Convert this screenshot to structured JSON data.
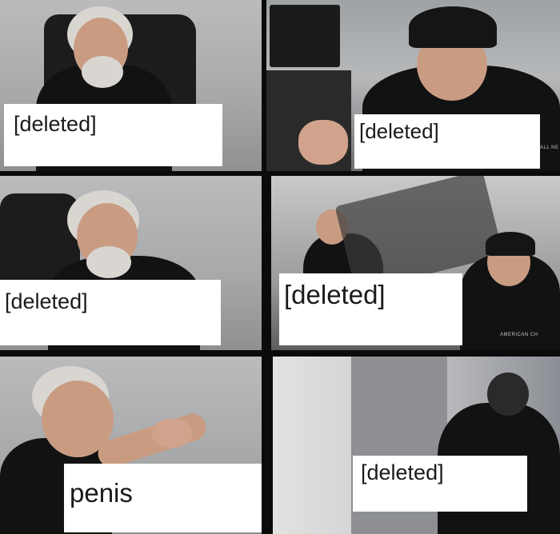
{
  "meme": {
    "template": "American Chopper argument",
    "panels": [
      {
        "caption": "[deleted]"
      },
      {
        "caption": "[deleted]"
      },
      {
        "caption": "[deleted]"
      },
      {
        "caption": "[deleted]"
      },
      {
        "caption": "penis"
      },
      {
        "caption": "[deleted]"
      }
    ]
  },
  "colors": {
    "border": "#0b0b0b",
    "caption_bg": "#ffffff",
    "caption_text": "#1a1a1a"
  }
}
